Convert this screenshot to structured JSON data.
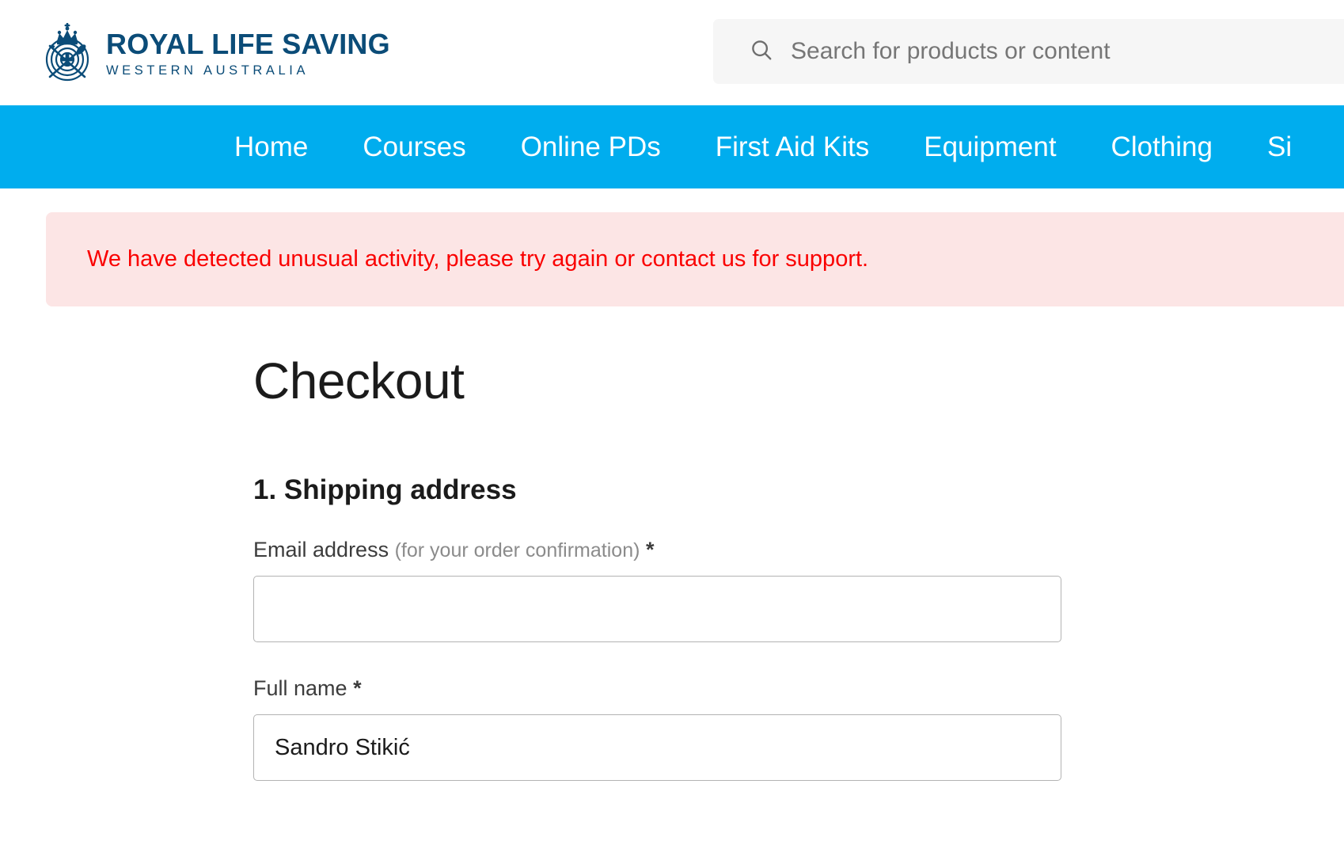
{
  "header": {
    "brand": {
      "emblem_icon": "royal-life-saving-crest-icon",
      "line1": "ROYAL LIFE SAVING",
      "line2": "WESTERN AUSTRALIA"
    },
    "search": {
      "icon": "search-icon",
      "placeholder": "Search for products or content",
      "value": ""
    }
  },
  "nav": {
    "items": [
      {
        "label": "Home"
      },
      {
        "label": "Courses"
      },
      {
        "label": "Online PDs"
      },
      {
        "label": "First Aid Kits"
      },
      {
        "label": "Equipment"
      },
      {
        "label": "Clothing"
      },
      {
        "label": "Si"
      }
    ]
  },
  "alert": {
    "type": "error",
    "message": "We have detected unusual activity, please try again or contact us for support.",
    "text_color": "#fa0000",
    "background_color": "#fce5e5"
  },
  "main": {
    "page_title": "Checkout",
    "section": {
      "title": "1. Shipping address",
      "fields": [
        {
          "label": "Email address",
          "hint": "(for your order confirmation)",
          "required_marker": "*",
          "value": "",
          "placeholder": ""
        },
        {
          "label": "Full name",
          "hint": "",
          "required_marker": "*",
          "value": "Sandro Stikić",
          "placeholder": ""
        }
      ]
    }
  },
  "theme": {
    "nav_background": "#00ADEE",
    "brand_color": "#0b4c78",
    "search_background": "#f6f6f6"
  }
}
